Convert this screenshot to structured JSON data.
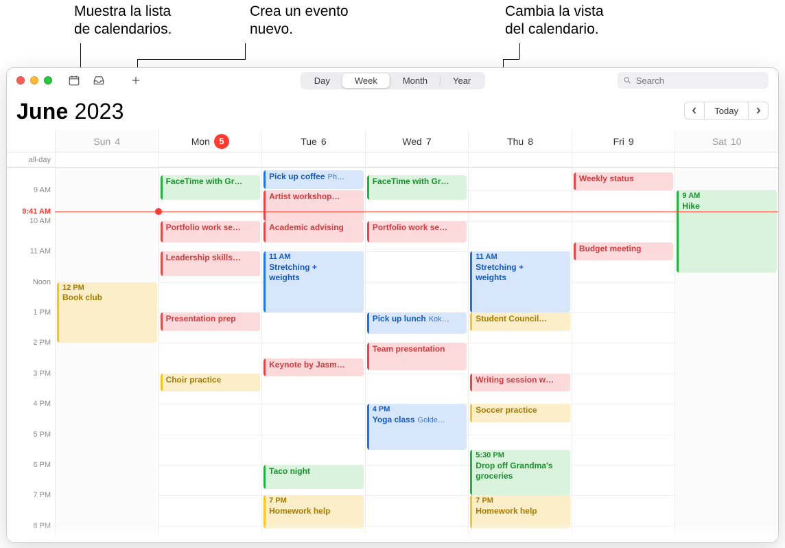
{
  "callouts": {
    "calendars": "Muestra la lista\nde calendarios.",
    "new_event": "Crea un evento\nnuevo.",
    "view": "Cambia la vista\ndel calendario."
  },
  "toolbar": {
    "segments": [
      "Day",
      "Week",
      "Month",
      "Year"
    ],
    "active_segment": "Week",
    "search_placeholder": "Search"
  },
  "title": {
    "month": "June",
    "year": "2023",
    "today_label": "Today"
  },
  "days": [
    {
      "label": "Sun",
      "num": "4",
      "dim": true
    },
    {
      "label": "Mon",
      "num": "5",
      "today": true
    },
    {
      "label": "Tue",
      "num": "6"
    },
    {
      "label": "Wed",
      "num": "7"
    },
    {
      "label": "Thu",
      "num": "8"
    },
    {
      "label": "Fri",
      "num": "9"
    },
    {
      "label": "Sat",
      "num": "10",
      "dim": true
    }
  ],
  "allday_label": "all-day",
  "hours": [
    {
      "t": "9 AM",
      "h": 9
    },
    {
      "t": "10 AM",
      "h": 10
    },
    {
      "t": "11 AM",
      "h": 11
    },
    {
      "t": "Noon",
      "h": 12
    },
    {
      "t": "1 PM",
      "h": 13
    },
    {
      "t": "2 PM",
      "h": 14
    },
    {
      "t": "3 PM",
      "h": 15
    },
    {
      "t": "4 PM",
      "h": 16
    },
    {
      "t": "5 PM",
      "h": 17
    },
    {
      "t": "6 PM",
      "h": 18
    },
    {
      "t": "7 PM",
      "h": 19
    },
    {
      "t": "8 PM",
      "h": 20
    }
  ],
  "grid": {
    "start_hour": 8.25,
    "end_hour": 20.5,
    "now_hour": 9.6833,
    "now_label": "9:41 AM",
    "now_col": 1
  },
  "events": [
    {
      "day": 0,
      "start": 12,
      "end": 14,
      "color": "yellow",
      "time": "12 PM",
      "title": "Book club"
    },
    {
      "day": 1,
      "start": 8.5,
      "end": 9.3,
      "color": "green",
      "title": "FaceTime with Gr…"
    },
    {
      "day": 1,
      "start": 10,
      "end": 10.7,
      "color": "red",
      "title": "Portfolio work se…"
    },
    {
      "day": 1,
      "start": 11,
      "end": 11.8,
      "color": "red",
      "title": "Leadership skills…"
    },
    {
      "day": 1,
      "start": 13,
      "end": 13.6,
      "color": "red",
      "title": "Presentation prep"
    },
    {
      "day": 1,
      "start": 15,
      "end": 15.6,
      "color": "yellow",
      "title": "Choir practice"
    },
    {
      "day": 2,
      "start": 8.35,
      "end": 8.95,
      "color": "blue",
      "title": "Pick up coffee",
      "sub": "Ph…"
    },
    {
      "day": 2,
      "start": 9,
      "end": 10,
      "color": "red",
      "title": "Artist workshop…"
    },
    {
      "day": 2,
      "start": 10,
      "end": 10.7,
      "color": "red",
      "title": "Academic advising"
    },
    {
      "day": 2,
      "start": 11,
      "end": 13,
      "color": "blue",
      "time": "11 AM",
      "title": "Stretching +\nweights"
    },
    {
      "day": 2,
      "start": 14.5,
      "end": 15.1,
      "color": "red",
      "title": "Keynote by Jasm…"
    },
    {
      "day": 2,
      "start": 18,
      "end": 18.8,
      "color": "green",
      "title": "Taco night"
    },
    {
      "day": 2,
      "start": 19,
      "end": 20.1,
      "color": "yellow",
      "time": "7 PM",
      "title": "Homework help"
    },
    {
      "day": 3,
      "start": 8.5,
      "end": 9.3,
      "color": "green",
      "title": "FaceTime with Gr…"
    },
    {
      "day": 3,
      "start": 10,
      "end": 10.7,
      "color": "red",
      "title": "Portfolio work se…"
    },
    {
      "day": 3,
      "start": 13,
      "end": 13.7,
      "color": "blue",
      "title": "Pick up lunch",
      "sub": "Kok…"
    },
    {
      "day": 3,
      "start": 14,
      "end": 14.9,
      "color": "red",
      "title": "Team presentation"
    },
    {
      "day": 3,
      "start": 16,
      "end": 17.5,
      "color": "blue",
      "time": "4 PM",
      "title": "Yoga class",
      "sub": "Golde…"
    },
    {
      "day": 4,
      "start": 11,
      "end": 13,
      "color": "blue",
      "time": "11 AM",
      "title": "Stretching +\nweights"
    },
    {
      "day": 4,
      "start": 13,
      "end": 13.6,
      "color": "yellow",
      "title": "Student Council…"
    },
    {
      "day": 4,
      "start": 15,
      "end": 15.6,
      "color": "red",
      "title": "Writing session w…"
    },
    {
      "day": 4,
      "start": 16,
      "end": 16.6,
      "color": "yellow",
      "title": "Soccer practice"
    },
    {
      "day": 4,
      "start": 17.5,
      "end": 19,
      "color": "green",
      "time": "5:30 PM",
      "title": "Drop off Grandma's\ngroceries"
    },
    {
      "day": 4,
      "start": 19,
      "end": 20.1,
      "color": "yellow",
      "time": "7 PM",
      "title": "Homework help"
    },
    {
      "day": 5,
      "start": 8.4,
      "end": 9.0,
      "color": "red",
      "title": "Weekly status"
    },
    {
      "day": 5,
      "start": 10.7,
      "end": 11.3,
      "color": "red",
      "title": "Budget meeting"
    },
    {
      "day": 6,
      "start": 9,
      "end": 11.7,
      "color": "green",
      "time": "9 AM",
      "title": "Hike"
    }
  ]
}
